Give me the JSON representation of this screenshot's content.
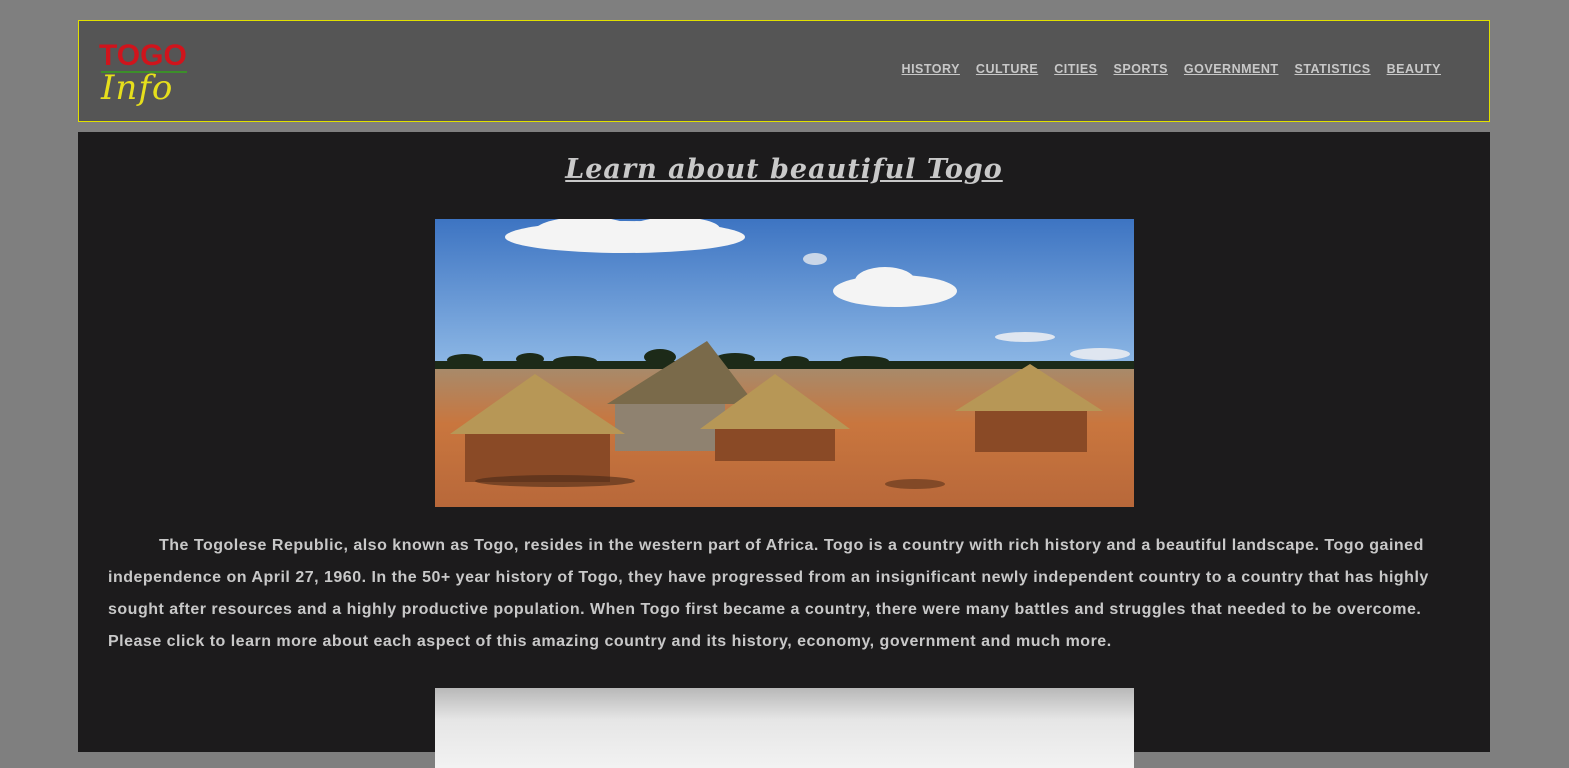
{
  "header": {
    "logo": {
      "line1": "TOGO",
      "line2": "Info"
    },
    "nav": [
      "HISTORY",
      "CULTURE",
      "CITIES",
      "SPORTS",
      "GOVERNMENT",
      "STATISTICS",
      "BEAUTY"
    ]
  },
  "main": {
    "title": "Learn about beautiful Togo",
    "hero_image": "thatched-huts-landscape",
    "paragraph": "The Togolese Republic, also known as Togo, resides in the western part of Africa. Togo is a country with rich history and a beautiful landscape. Togo gained independence on April 27, 1960. In the 50+ year history of Togo, they have progressed from an insignificant newly independent country to a country that has highly sought after resources and a highly productive population. When Togo first became a country, there were many battles and struggles that needed to be overcome. Please click to learn more about each aspect of this amazing country and its history, economy, government and much more.",
    "second_image": "grayscale-photo"
  },
  "colors": {
    "page_bg": "#7f7f7f",
    "header_bg": "#555555",
    "header_border": "#e1e000",
    "main_bg": "#1c1b1c",
    "logo_red": "#d0141c",
    "logo_yellow": "#e6df1c",
    "text": "#c8c8c8"
  }
}
